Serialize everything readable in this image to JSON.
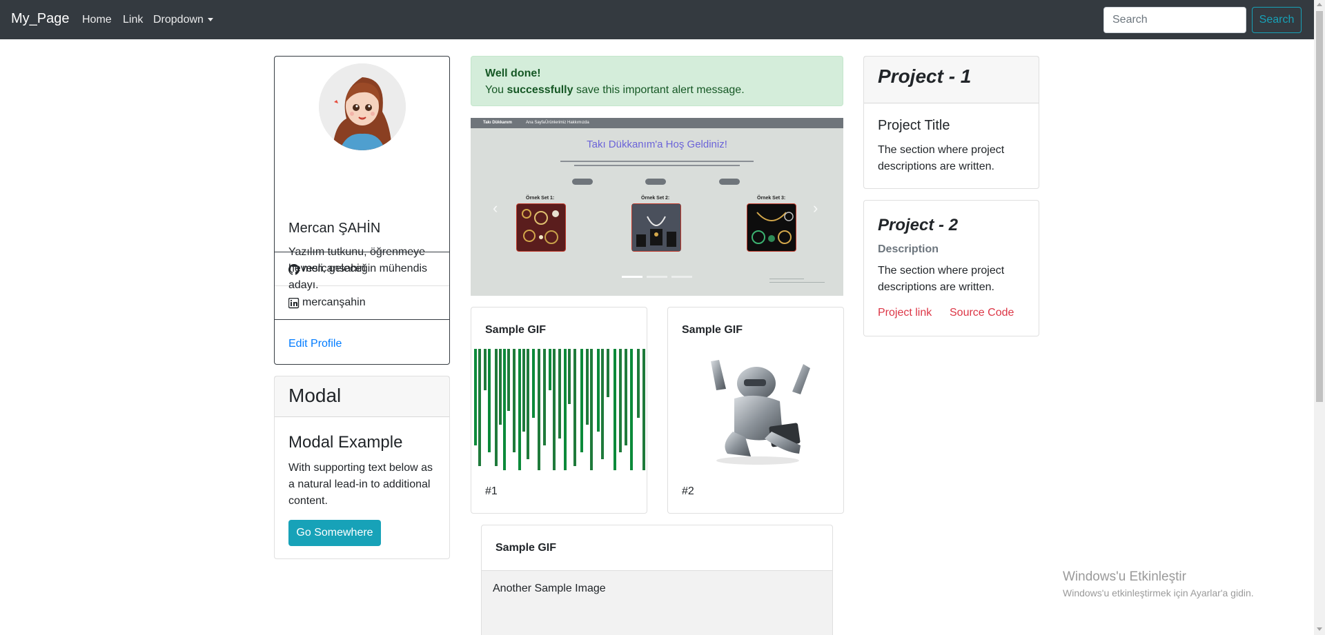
{
  "navbar": {
    "brand": "My_Page",
    "links": [
      "Home",
      "Link",
      "Dropdown"
    ],
    "search_placeholder": "Search",
    "search_button": "Search"
  },
  "profile": {
    "name": "Mercan ŞAHİN",
    "bio": "Yazılım tutkunu, öğrenmeye hevesli, geleceğin mühendis adayı.",
    "github": "mercansahin",
    "linkedin": "mercanşahin",
    "edit_link": "Edit Profile"
  },
  "modal_card": {
    "header": "Modal",
    "title": "Modal Example",
    "text": "With supporting text below as a natural lead-in to additional content.",
    "button": "Go Somewhere"
  },
  "alert": {
    "title": "Well done!",
    "prefix": "You",
    "bold": "successfully",
    "suffix": "save this important alert message."
  },
  "carousel": {
    "nav_brand": "Takı Dükkanım",
    "nav_items": [
      "Ana Sayfa",
      "Ürünlerimiz",
      "Hakkımızda"
    ],
    "title": "Takı Dükkanım'a Hoş Geldiniz!",
    "sets": [
      "Örnek Set 1:",
      "Örnek Set 2:",
      "Örnek Set 3:"
    ],
    "active_slide": 1,
    "slide_count": 3
  },
  "gif_cards": [
    {
      "title": "Sample GIF",
      "caption": "#1"
    },
    {
      "title": "Sample GIF",
      "caption": "#2"
    }
  ],
  "gif_card_3": {
    "title": "Sample GIF",
    "body": "Another Sample Image"
  },
  "project_1": {
    "header": "Project - 1",
    "title": "Project Title",
    "text": "The section where project descriptions are written."
  },
  "project_2": {
    "title": "Project - 2",
    "subtitle": "Description",
    "text": "The section where project descriptions are written.",
    "link_1": "Project link",
    "link_2": "Source Code"
  },
  "watermark": {
    "line1": "Windows'u Etkinleştir",
    "line2": "Windows'u etkinleştirmek için Ayarlar'a gidin."
  },
  "colors": {
    "navbar": "#343a40",
    "info": "#17a2b8",
    "link": "#007bff",
    "danger": "#dc3545",
    "alert_bg": "#d4edda"
  }
}
